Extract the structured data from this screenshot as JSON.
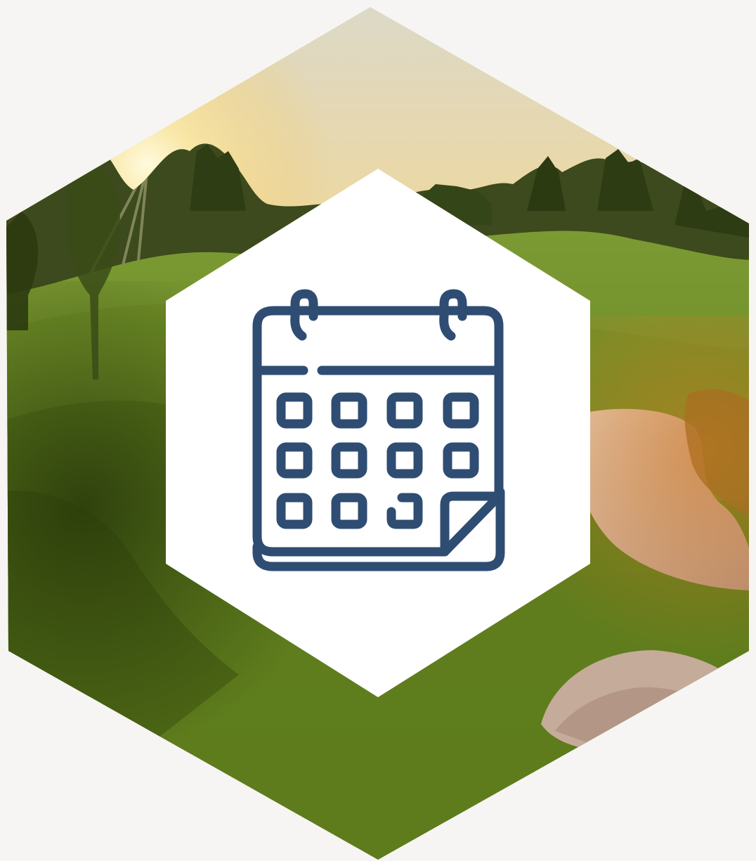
{
  "graphic": {
    "icon": "calendar-icon",
    "background_scene": "golf-course-sunset",
    "colors": {
      "page_background": "#f6f5f3",
      "icon_stroke": "#2f4d73",
      "inner_hexagon": "#ffffff",
      "sky_light": "#f5d98a",
      "fairway": "#6d8f28",
      "sand_bunker": "#d9bca6"
    }
  }
}
